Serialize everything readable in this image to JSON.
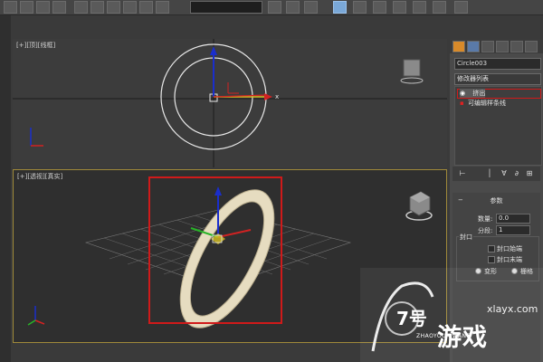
{
  "viewports": {
    "top_label": "[+][顶][线框]",
    "persp_label": "[+][透视][真实]"
  },
  "command_panel": {
    "object_name": "Circle003",
    "modifier_list": "修改器列表",
    "stack": {
      "items": [
        {
          "label": "挤出",
          "selected": true
        },
        {
          "label": "可编辑样条线",
          "selected": false
        }
      ]
    },
    "rollout": {
      "title": "参数",
      "amount_label": "数量:",
      "amount_value": "0.0",
      "segments_label": "分段:",
      "segments_value": "1",
      "capping_label": "封口",
      "cap_start_label": "封口始端",
      "cap_end_label": "封口末端",
      "morph_label": "变形",
      "grid_label": "栅格"
    }
  },
  "watermark": {
    "url": "xlayx.com",
    "big_text": "游戏",
    "sub_text": "ZHAOYOUXIWANG",
    "logo_char": "7号"
  },
  "colors": {
    "highlight_red": "#d01a1a",
    "ring_fill": "#e6dcc0",
    "axis_blue": "#1a2ecc",
    "axis_green": "#28b428",
    "axis_red": "#d22222"
  }
}
